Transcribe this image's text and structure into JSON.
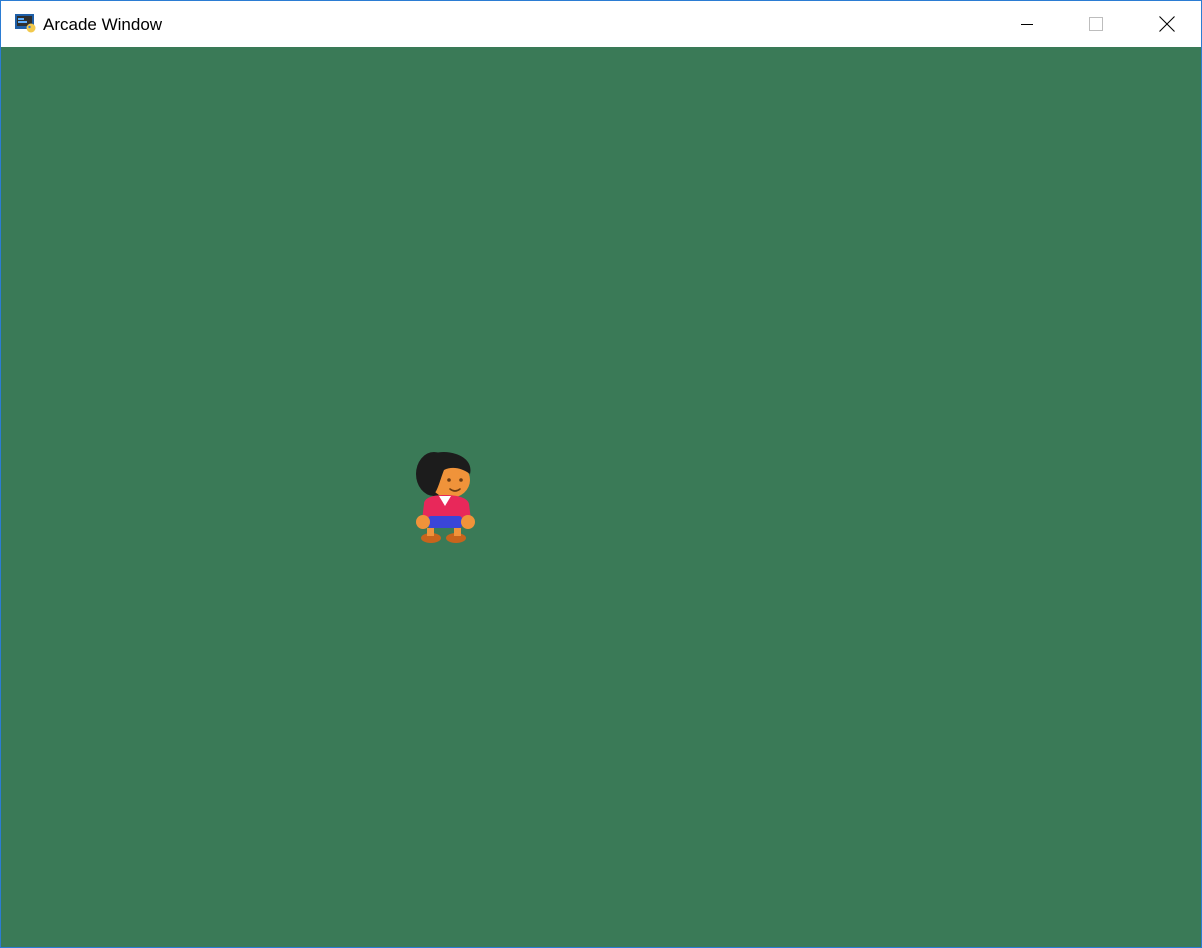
{
  "window": {
    "title": "Arcade Window",
    "app_icon": "arcade-app-icon",
    "controls": {
      "minimize_icon": "minimize-icon",
      "maximize_icon": "maximize-icon",
      "close_icon": "close-icon"
    }
  },
  "canvas": {
    "background_color": "#3a7a57",
    "sprite": "player-character-sprite"
  }
}
